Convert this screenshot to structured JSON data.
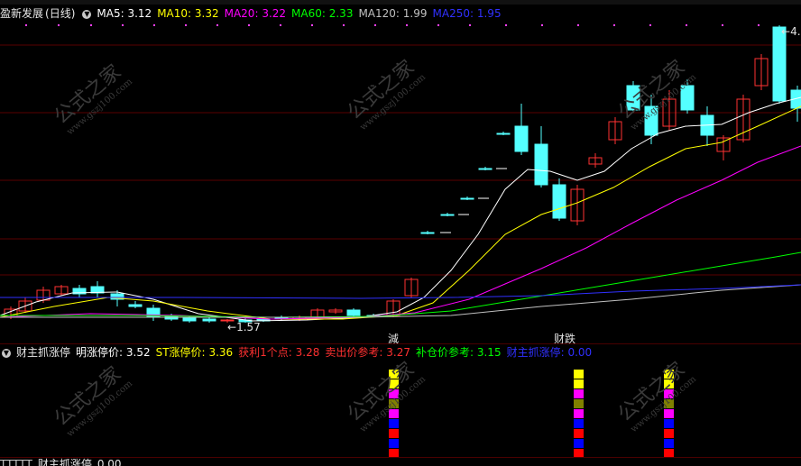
{
  "main": {
    "stock_name": "盈新发展",
    "period": "(日线)",
    "ma": [
      {
        "label": "MA5:",
        "value": "3.12",
        "color": "#ffffff"
      },
      {
        "label": "MA10:",
        "value": "3.32",
        "color": "#ffff00"
      },
      {
        "label": "MA20:",
        "value": "3.22",
        "color": "#ff00ff"
      },
      {
        "label": "MA60:",
        "value": "2.33",
        "color": "#00ff00"
      },
      {
        "label": "MA120:",
        "value": "1.99",
        "color": "#c0c0c0"
      },
      {
        "label": "MA250:",
        "value": "1.95",
        "color": "#3030ff"
      }
    ],
    "low_marker": "1.57",
    "high_marker": "4.",
    "sig_jian": "減",
    "sig_caidie": "财跌"
  },
  "sub": {
    "title": "财主抓涨停",
    "items": [
      {
        "label": "明涨停价:",
        "value": "3.52",
        "color": "#ffffff"
      },
      {
        "label": "ST涨停价:",
        "value": "3.36",
        "color": "#ffff00"
      },
      {
        "label": "获利1个点:",
        "value": "3.28",
        "color": "#ff3030"
      },
      {
        "label": "卖出价参考:",
        "value": "3.27",
        "color": "#ff3030"
      },
      {
        "label": "补仓价参考:",
        "value": "3.15",
        "color": "#00ff00"
      },
      {
        "label": "财主抓涨停:",
        "value": "0.00",
        "color": "#3030ff"
      }
    ]
  },
  "bottom": {
    "title": "财主抓涨停",
    "value": "0.00"
  },
  "watermark": {
    "text": "公式之家",
    "url": "www.gszj100.com"
  },
  "colors": {
    "up": "#ff3232",
    "down": "#54ffff",
    "ma5": "#ffffff",
    "ma10": "#ffff00",
    "ma20": "#ff00ff",
    "ma60": "#00ff00",
    "ma120": "#c0c0c0",
    "ma250": "#3030ff"
  }
}
